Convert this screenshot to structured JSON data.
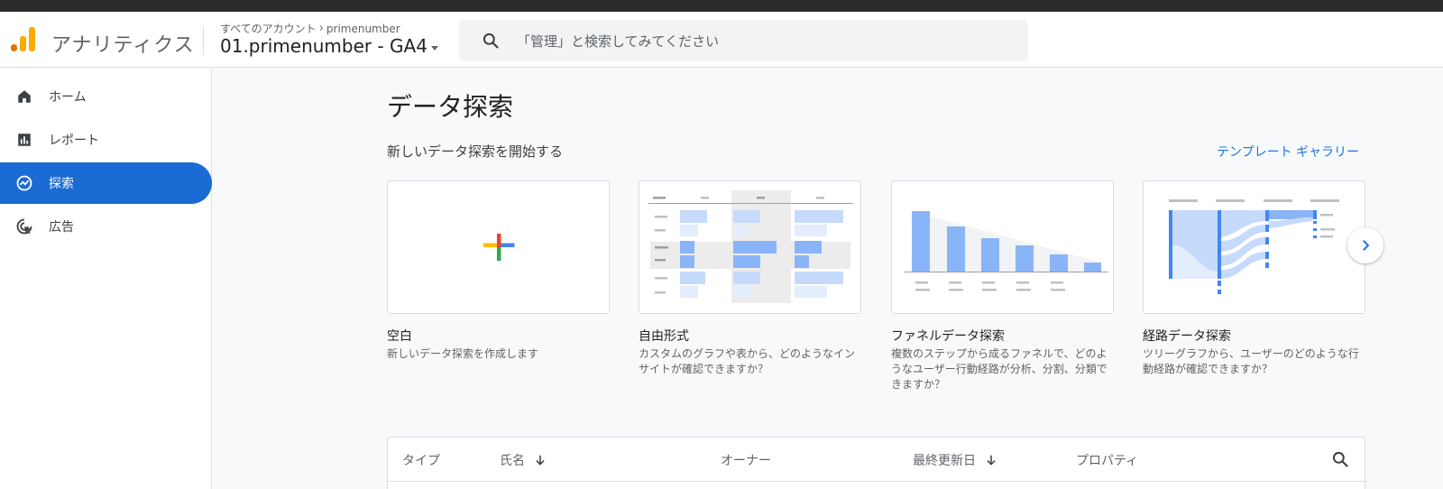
{
  "header": {
    "app_name": "アナリティクス",
    "breadcrumb_root": "すべてのアカウント",
    "breadcrumb_account": "primenumber",
    "property_name": "01.primenumber - GA4",
    "search_placeholder": "「管理」と検索してみてください"
  },
  "sidebar": {
    "items": [
      {
        "label": "ホーム",
        "icon": "home-icon"
      },
      {
        "label": "レポート",
        "icon": "bar-chart-icon"
      },
      {
        "label": "探索",
        "icon": "explore-icon",
        "active": true
      },
      {
        "label": "広告",
        "icon": "ads-cursor-icon"
      }
    ]
  },
  "main": {
    "title": "データ探索",
    "subtitle": "新しいデータ探索を開始する",
    "template_gallery_link": "テンプレート ギャラリー",
    "cards": [
      {
        "title": "空白",
        "desc": "新しいデータ探索を作成します"
      },
      {
        "title": "自由形式",
        "desc": "カスタムのグラフや表から、どのようなインサイトが確認できますか？"
      },
      {
        "title": "ファネルデータ探索",
        "desc": "複数のステップから成るファネルで、どのようなユーザー行動経路が分析、分割、分類できますか？"
      },
      {
        "title": "経路データ探索",
        "desc": "ツリーグラフから、ユーザーのどのような行動経路が確認できますか？"
      }
    ]
  },
  "table": {
    "headers": {
      "type": "タイプ",
      "name": "氏名",
      "owner": "オーナー",
      "last_modified": "最終更新日",
      "property": "プロパティ"
    }
  },
  "colors": {
    "accent": "#1a73e8",
    "nav_active": "#1a6bd4",
    "chart_blue": "#8ab4f8",
    "logo_orange": "#f9ab00",
    "logo_dark_orange": "#e37400"
  }
}
